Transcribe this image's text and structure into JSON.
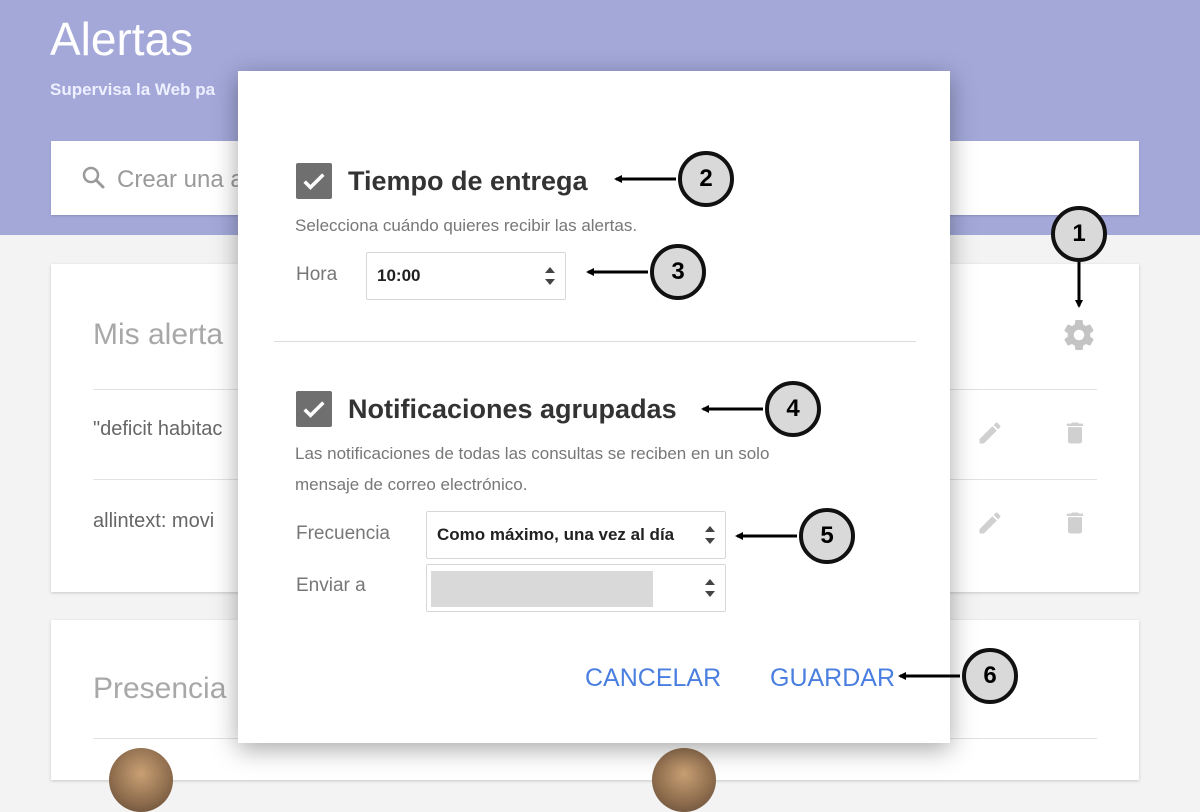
{
  "header": {
    "title": "Alertas",
    "subtitle": "Supervisa la Web pa"
  },
  "search": {
    "placeholder": "Crear una a"
  },
  "alerts_card": {
    "title": "Mis alerta",
    "rows": [
      "\"deficit habitac",
      "allintext: movi"
    ]
  },
  "presence_card": {
    "title": "Presencia"
  },
  "dialog": {
    "delivery": {
      "title": "Tiempo de entrega",
      "description": "Selecciona cuándo quieres recibir las alertas.",
      "hour_label": "Hora",
      "hour_value": "10:00"
    },
    "digest": {
      "title": "Notificaciones agrupadas",
      "description_line1": "Las notificaciones de todas las consultas se reciben en un solo",
      "description_line2": "mensaje de correo electrónico.",
      "frequency_label": "Frecuencia",
      "frequency_value": "Como máximo, una vez al día",
      "send_to_label": "Enviar a"
    },
    "cancel_label": "CANCELAR",
    "save_label": "GUARDAR"
  },
  "callouts": [
    "1",
    "2",
    "3",
    "4",
    "5",
    "6"
  ],
  "colors": {
    "header_bg": "#a3a8d9",
    "button_blue": "#4a7fe0",
    "checkbox": "#6f6f6f"
  },
  "icons": [
    "search-icon",
    "gear-icon",
    "pencil-icon",
    "trash-icon",
    "check-icon",
    "sort-arrows-icon"
  ]
}
